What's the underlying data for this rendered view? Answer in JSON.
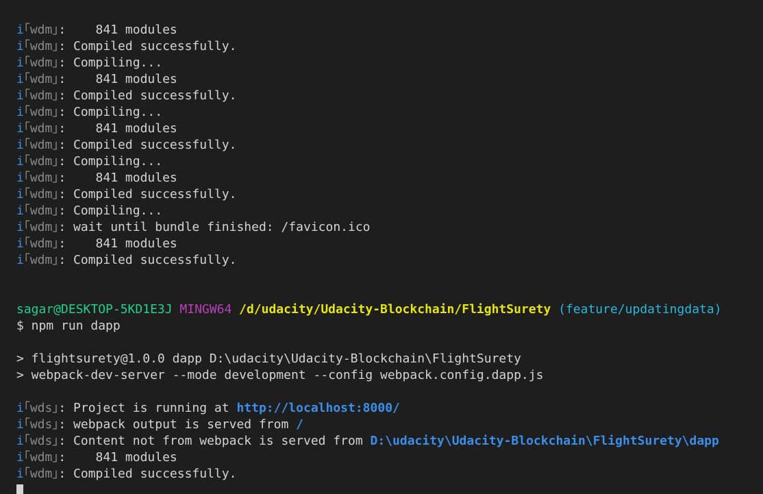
{
  "log_lines_top": [
    {
      "mark": "i",
      "tag": "｢wdm｣",
      "text": ":    841 modules"
    },
    {
      "mark": "i",
      "tag": "｢wdm｣",
      "text": ": Compiled successfully."
    },
    {
      "mark": "i",
      "tag": "｢wdm｣",
      "text": ": Compiling..."
    },
    {
      "mark": "i",
      "tag": "｢wdm｣",
      "text": ":    841 modules"
    },
    {
      "mark": "i",
      "tag": "｢wdm｣",
      "text": ": Compiled successfully."
    },
    {
      "mark": "i",
      "tag": "｢wdm｣",
      "text": ": Compiling..."
    },
    {
      "mark": "i",
      "tag": "｢wdm｣",
      "text": ":    841 modules"
    },
    {
      "mark": "i",
      "tag": "｢wdm｣",
      "text": ": Compiled successfully."
    },
    {
      "mark": "i",
      "tag": "｢wdm｣",
      "text": ": Compiling..."
    },
    {
      "mark": "i",
      "tag": "｢wdm｣",
      "text": ":    841 modules"
    },
    {
      "mark": "i",
      "tag": "｢wdm｣",
      "text": ": Compiled successfully."
    },
    {
      "mark": "i",
      "tag": "｢wdm｣",
      "text": ": Compiling..."
    },
    {
      "mark": "i",
      "tag": "｢wdm｣",
      "text": ": wait until bundle finished: /favicon.ico"
    },
    {
      "mark": "i",
      "tag": "｢wdm｣",
      "text": ":    841 modules"
    },
    {
      "mark": "i",
      "tag": "｢wdm｣",
      "text": ": Compiled successfully."
    }
  ],
  "prompt": {
    "user": "sagar@DESKTOP-5KD1E3J",
    "system": "MINGW64",
    "path": "/d/udacity/Udacity-Blockchain/FlightSurety",
    "branch": "(feature/updatingdata)"
  },
  "command": "$ npm run dapp",
  "npm_output": [
    "> flightsurety@1.0.0 dapp D:\\udacity\\Udacity-Blockchain\\FlightSurety",
    "> webpack-dev-server --mode development --config webpack.config.dapp.js"
  ],
  "wds_lines": [
    {
      "mark": "i",
      "tag": "｢wds｣",
      "text": ": Project is running at ",
      "link": "http://localhost:8000/"
    },
    {
      "mark": "i",
      "tag": "｢wds｣",
      "text": ": webpack output is served from ",
      "link": "/"
    },
    {
      "mark": "i",
      "tag": "｢wds｣",
      "text": ": Content not from webpack is served from ",
      "link": "D:\\udacity\\Udacity-Blockchain\\FlightSurety\\dapp"
    }
  ],
  "log_lines_bottom": [
    {
      "mark": "i",
      "tag": "｢wdm｣",
      "text": ":    841 modules"
    },
    {
      "mark": "i",
      "tag": "｢wdm｣",
      "text": ": Compiled successfully."
    }
  ],
  "colors": {
    "background": "#1e1e1e",
    "info_mark": "#3b8eea",
    "user": "#23d18b",
    "system": "#bc3fbc",
    "path": "#e5e510",
    "branch": "#29b8db"
  }
}
